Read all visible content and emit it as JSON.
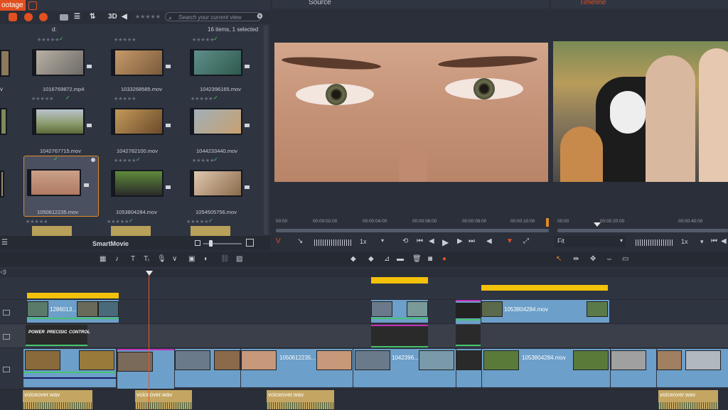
{
  "library": {
    "tab_label": "ootage",
    "toolbar_3d": "3D",
    "search_placeholder": "Search your current view",
    "path": "d:",
    "item_count": "16 items, 1 selected",
    "rating": "★★★★★",
    "files": [
      "1016769872.mp4",
      "1033268585.mov",
      "1042396165.mov",
      "1042767715.mov",
      "1042782100.mov",
      "1044233440.mov",
      "1050612235.mov",
      "1053804284.mov",
      "1054505756.mov"
    ],
    "edge_letter": "v",
    "smartmovie_label": "SmartMovie",
    "check": "✓"
  },
  "source": {
    "title": "Source",
    "ruler": [
      "00:00",
      "00:00:02:00",
      "00:00:04:00",
      "00:00:06:00",
      "00:00:08:00",
      "00:00:10:00"
    ],
    "speed": "1x",
    "v_label": "V"
  },
  "timeline_preview": {
    "title": "Timeline",
    "ruler": [
      "00:00",
      "00:00:20:00",
      "00:00:40:00"
    ],
    "fit": "Fit",
    "speed": "1x"
  },
  "timeline": {
    "clips_track1": [
      "1286013...",
      "1053804284.mov"
    ],
    "titles_track2": [
      "POWER",
      "PRECISION",
      "CONTROL"
    ],
    "clips_track3": [
      "1050612235...",
      "1042396...",
      "1053804284.mov"
    ],
    "audio_label": "voiceover.wav"
  },
  "colors": {
    "accent": "#e2501f",
    "clip": "#6c9fc9",
    "marker": "#f3c10a",
    "audio": "#c4a662",
    "check": "#4fc46d"
  }
}
